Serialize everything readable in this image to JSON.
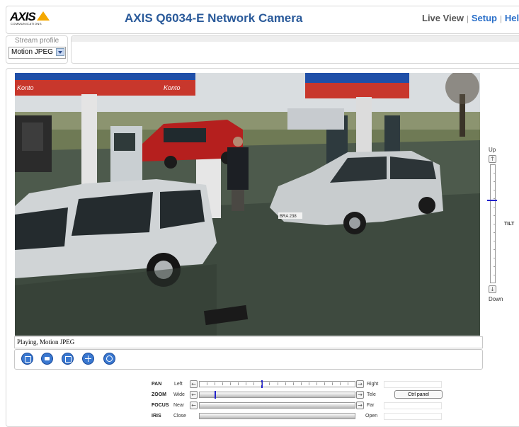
{
  "header": {
    "logo_text": "AXIS",
    "logo_sub": "COMMUNICATIONS",
    "title": "AXIS Q6034-E Network Camera",
    "nav": {
      "live_view": "Live View",
      "sep1": "|",
      "setup": "Setup",
      "sep2": "|",
      "help": "Help"
    }
  },
  "stream_profile": {
    "label": "Stream profile",
    "value": "Motion JPEG"
  },
  "video": {
    "status": "Playing, Motion JPEG",
    "sign_left": "Konto",
    "sign_right": "Konto",
    "plate": "BRA 238"
  },
  "toolbar": {
    "buttons": [
      "stop-icon",
      "snapshot-icon",
      "fullscreen-icon",
      "ptz-crosshair-icon",
      "record-icon"
    ]
  },
  "tilt": {
    "label": "TILT",
    "up": "Up",
    "down": "Down",
    "position": 0.3
  },
  "ptz": {
    "pan": {
      "label": "PAN",
      "min": "Left",
      "max": "Right",
      "position": 0.4
    },
    "zoom": {
      "label": "ZOOM",
      "min": "Wide",
      "max": "Tele",
      "position": 0.1
    },
    "focus": {
      "label": "FOCUS",
      "min": "Near",
      "max": "Far"
    },
    "iris": {
      "label": "IRIS",
      "min": "Close",
      "max": "Open"
    },
    "ctrl_panel": "Ctrl panel"
  },
  "colors": {
    "title_blue": "#2a5a9a",
    "link_blue": "#2a6fc9",
    "logo_yellow": "#f5a800",
    "button_blue": "#3a78d0",
    "thumb_blue": "#2222cc"
  }
}
